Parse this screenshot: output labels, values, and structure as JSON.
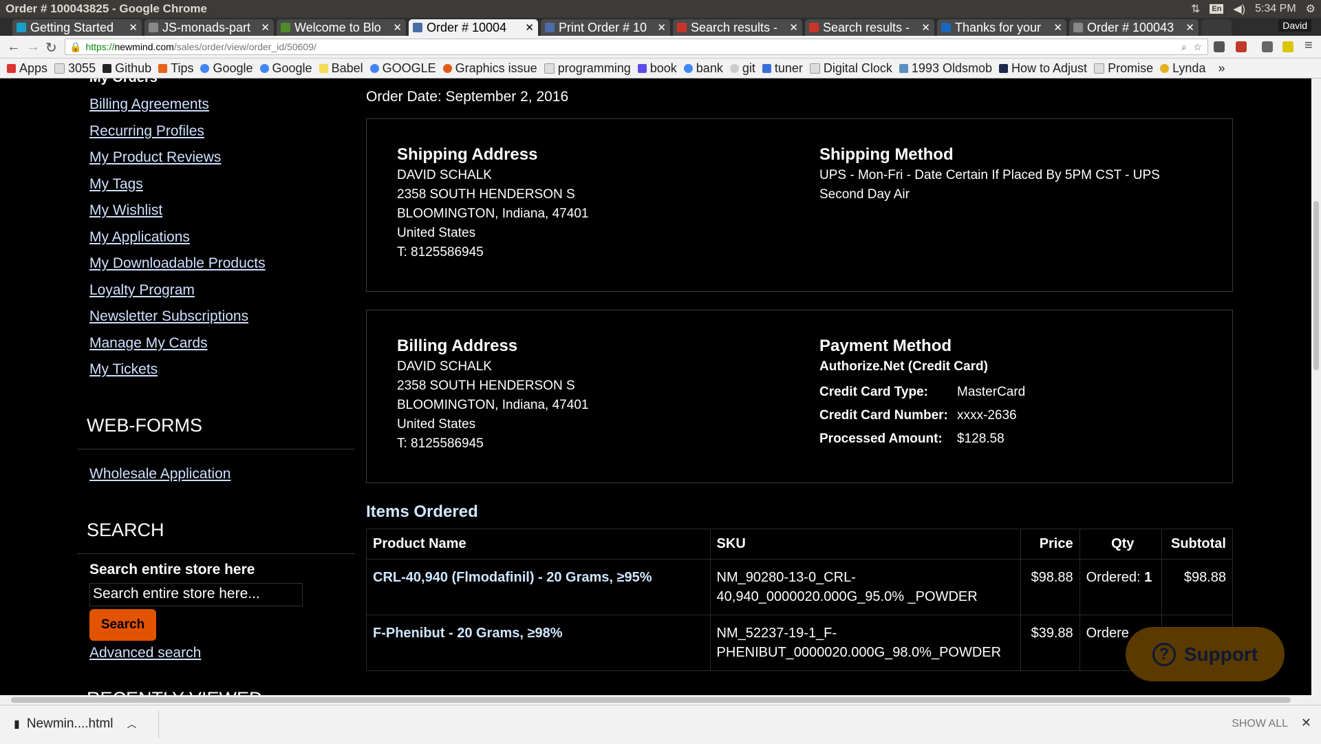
{
  "window": {
    "title": "Order # 100043825 - Google Chrome",
    "time": "5:34 PM",
    "lang": "En",
    "user": "David"
  },
  "tabs": [
    {
      "label": "Getting Started",
      "color": "#19a0c8"
    },
    {
      "label": "JS-monads-part",
      "color": "#888888"
    },
    {
      "label": "Welcome to Blo",
      "color": "#4f8a2a"
    },
    {
      "label": "Order # 10004",
      "color": "#4b6ea8",
      "active": true
    },
    {
      "label": "Print Order # 10",
      "color": "#4b6ea8"
    },
    {
      "label": "Search results -",
      "color": "#c8342a"
    },
    {
      "label": "Search results -",
      "color": "#c8342a"
    },
    {
      "label": "Thanks for your",
      "color": "#1a66c0"
    },
    {
      "label": "Order # 100043",
      "color": "#888888"
    }
  ],
  "url": {
    "scheme": "https://",
    "host": "newmind.com",
    "path": "/sales/order/view/order_id/50609/"
  },
  "bookmarks": [
    "Apps",
    "3055",
    "Github",
    "Tips",
    "Google",
    "Google",
    "Babel",
    "GOOGLE",
    "Graphics issue",
    "programming",
    "book",
    "bank",
    "git",
    "tuner",
    "Digital Clock",
    "1993 Oldsmob",
    "How to Adjust",
    "Promise",
    "Lynda"
  ],
  "sidebar": {
    "cut_heading": "My Orders",
    "links": [
      "Billing Agreements",
      "Recurring Profiles",
      "My Product Reviews",
      "My Tags",
      "My Wishlist",
      "My Applications",
      "My Downloadable Products",
      "Loyalty Program",
      "Newsletter Subscriptions",
      "Manage My Cards",
      "My Tickets"
    ],
    "webforms_heading": "WEB-FORMS",
    "webforms_link": "Wholesale Application",
    "search_heading": "SEARCH",
    "search_label": "Search entire store here",
    "search_placeholder": "Search entire store here...",
    "search_button": "Search",
    "advanced_search": "Advanced search",
    "recent_heading": "RECENTLY VIEWED"
  },
  "order": {
    "date": "Order Date: September 2, 2016",
    "shipping_address": {
      "title": "Shipping Address",
      "lines": [
        "DAVID SCHALK",
        "2358 SOUTH HENDERSON S",
        "BLOOMINGTON, Indiana, 47401",
        "United States",
        "T: 8125586945"
      ]
    },
    "shipping_method": {
      "title": "Shipping Method",
      "lines": [
        "UPS - Mon-Fri - Date Certain If Placed By 5PM CST - UPS",
        "Second Day Air"
      ]
    },
    "billing_address": {
      "title": "Billing Address",
      "lines": [
        "DAVID SCHALK",
        "2358 SOUTH HENDERSON S",
        "BLOOMINGTON, Indiana, 47401",
        "United States",
        "T: 8125586945"
      ]
    },
    "payment": {
      "title": "Payment Method",
      "provider": "Authorize.Net (Credit Card)",
      "card_type_label": "Credit Card Type:",
      "card_type": "MasterCard",
      "card_number_label": "Credit Card Number:",
      "card_number": "xxxx-2636",
      "amount_label": "Processed Amount:",
      "amount": "$128.58"
    },
    "items_title": "Items Ordered",
    "columns": [
      "Product Name",
      "SKU",
      "Price",
      "Qty",
      "Subtotal"
    ],
    "items": [
      {
        "name": "CRL-40,940 (Flmodafinil) - 20 Grams, ≥95%",
        "sku1": "NM_90280-13-0_CRL-",
        "sku2": "40,940_0000020.000G_95.0% _POWDER",
        "price": "$98.88",
        "qty_label": "Ordered:",
        "qty": "1",
        "subtotal": "$98.88"
      },
      {
        "name": "F-Phenibut - 20 Grams, ≥98%",
        "sku1": "NM_52237-19-1_F-",
        "sku2": "PHENIBUT_0000020.000G_98.0%_POWDER",
        "price": "$39.88",
        "qty_label": "Ordere",
        "qty": "",
        "subtotal": ""
      }
    ]
  },
  "support": "Support",
  "downloads": {
    "file": "Newmin....html",
    "show_all": "SHOW ALL"
  }
}
